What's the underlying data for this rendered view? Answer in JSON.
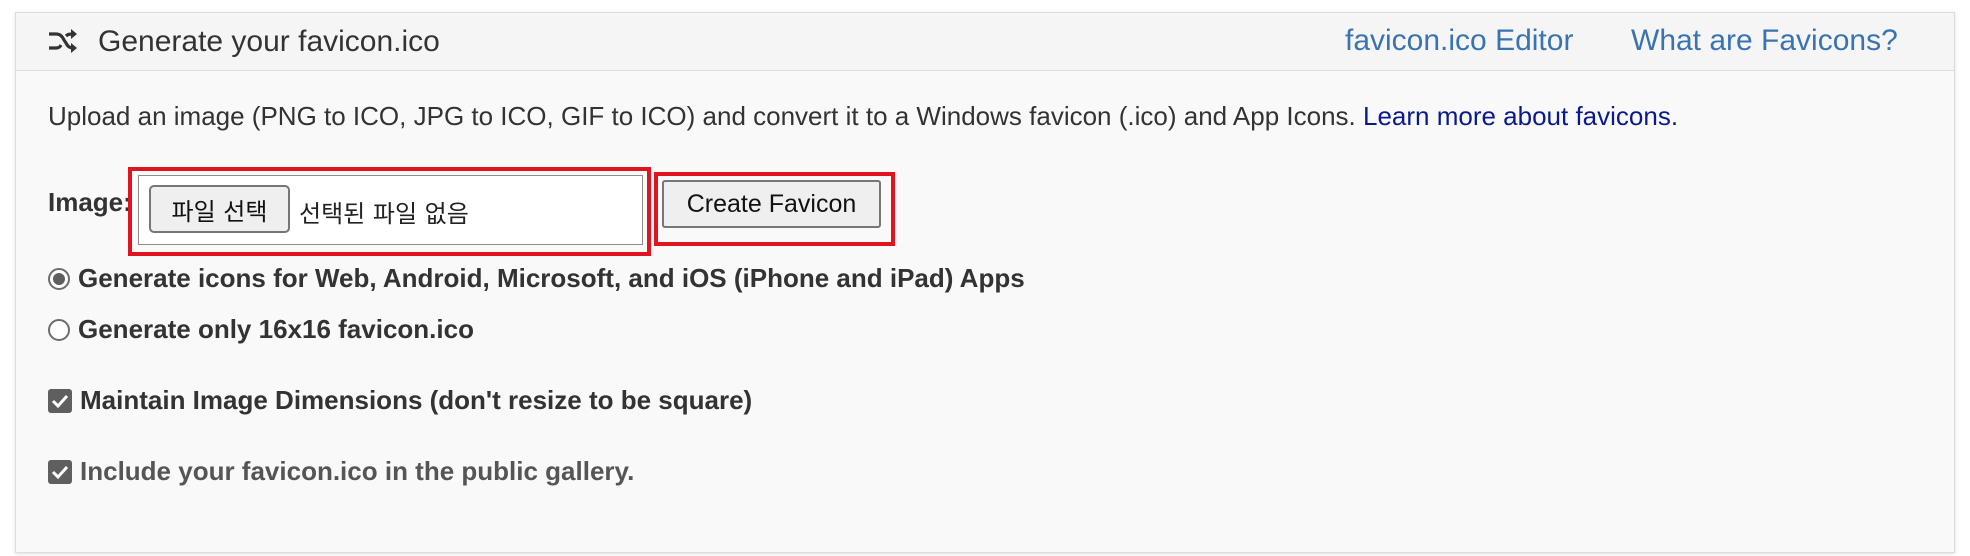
{
  "header": {
    "title": "Generate your favicon.ico",
    "links": [
      {
        "label": "favicon.ico Editor"
      },
      {
        "label": "What are Favicons?"
      }
    ],
    "icon": "shuffle-icon"
  },
  "intro": {
    "text": "Upload an image (PNG to ICO, JPG to ICO, GIF to ICO) and convert it to a Windows favicon (.ico) and App Icons. ",
    "link": "Learn more about favicons."
  },
  "form": {
    "image_label": "Image:",
    "file_button": "파일 선택",
    "file_status": "선택된 파일 없음",
    "create_button": "Create Favicon",
    "options": [
      {
        "type": "radio",
        "checked": true,
        "label": "Generate icons for Web, Android, Microsoft, and iOS (iPhone and iPad) Apps"
      },
      {
        "type": "radio",
        "checked": false,
        "label": "Generate only 16x16 favicon.ico"
      },
      {
        "type": "checkbox",
        "checked": true,
        "label": "Maintain Image Dimensions (don't resize to be square)"
      },
      {
        "type": "checkbox",
        "checked": true,
        "label": "Include your favicon.ico in the public gallery."
      }
    ]
  },
  "colors": {
    "link": "#3a73b1",
    "intro_link": "#0a1a8e",
    "highlight": "#e0141e",
    "control_fill": "#5f5f5f"
  }
}
